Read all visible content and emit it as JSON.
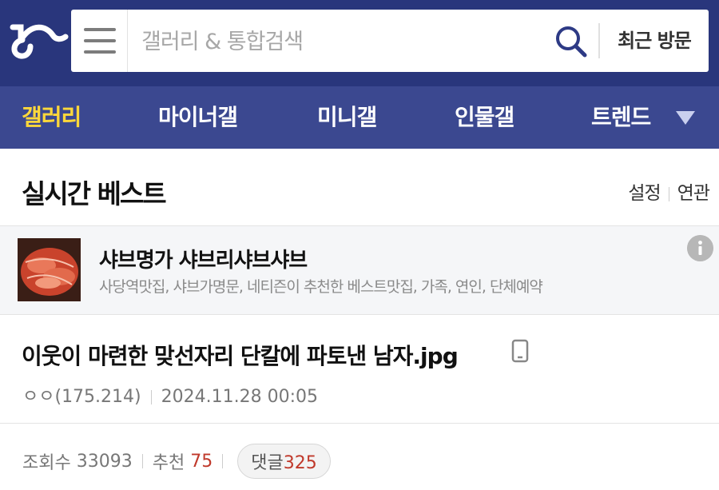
{
  "header": {
    "search_placeholder": "갤러리 & 통합검색",
    "recent_label": "최근 방문"
  },
  "gnb": {
    "items": [
      "갤러리",
      "마이너갤",
      "미니갤",
      "인물갤",
      "트렌드"
    ],
    "active_index": 0
  },
  "section": {
    "title": "실시간 베스트",
    "links": [
      "설정",
      "연관"
    ]
  },
  "ad": {
    "title": "샤브명가 샤브리샤브샤브",
    "description": "사당역맛집, 샤브가명문, 네티즌이 추천한 베스트맛집, 가족, 연인, 단체예약"
  },
  "post": {
    "title": "이웃이 마련한 맞선자리 단칼에 파토낸 남자.jpg",
    "author": "ㅇㅇ(175.214)",
    "datetime": "2024.11.28 00:05"
  },
  "stats": {
    "views_label": "조회수",
    "views": "33093",
    "recommend_label": "추천",
    "recommend": "75",
    "comments_label": "댓글",
    "comments": "325"
  },
  "colors": {
    "topbar": "#29367c",
    "gnb": "#3b4890",
    "active_tab": "#ffd83a",
    "accent_red": "#c0392b"
  }
}
